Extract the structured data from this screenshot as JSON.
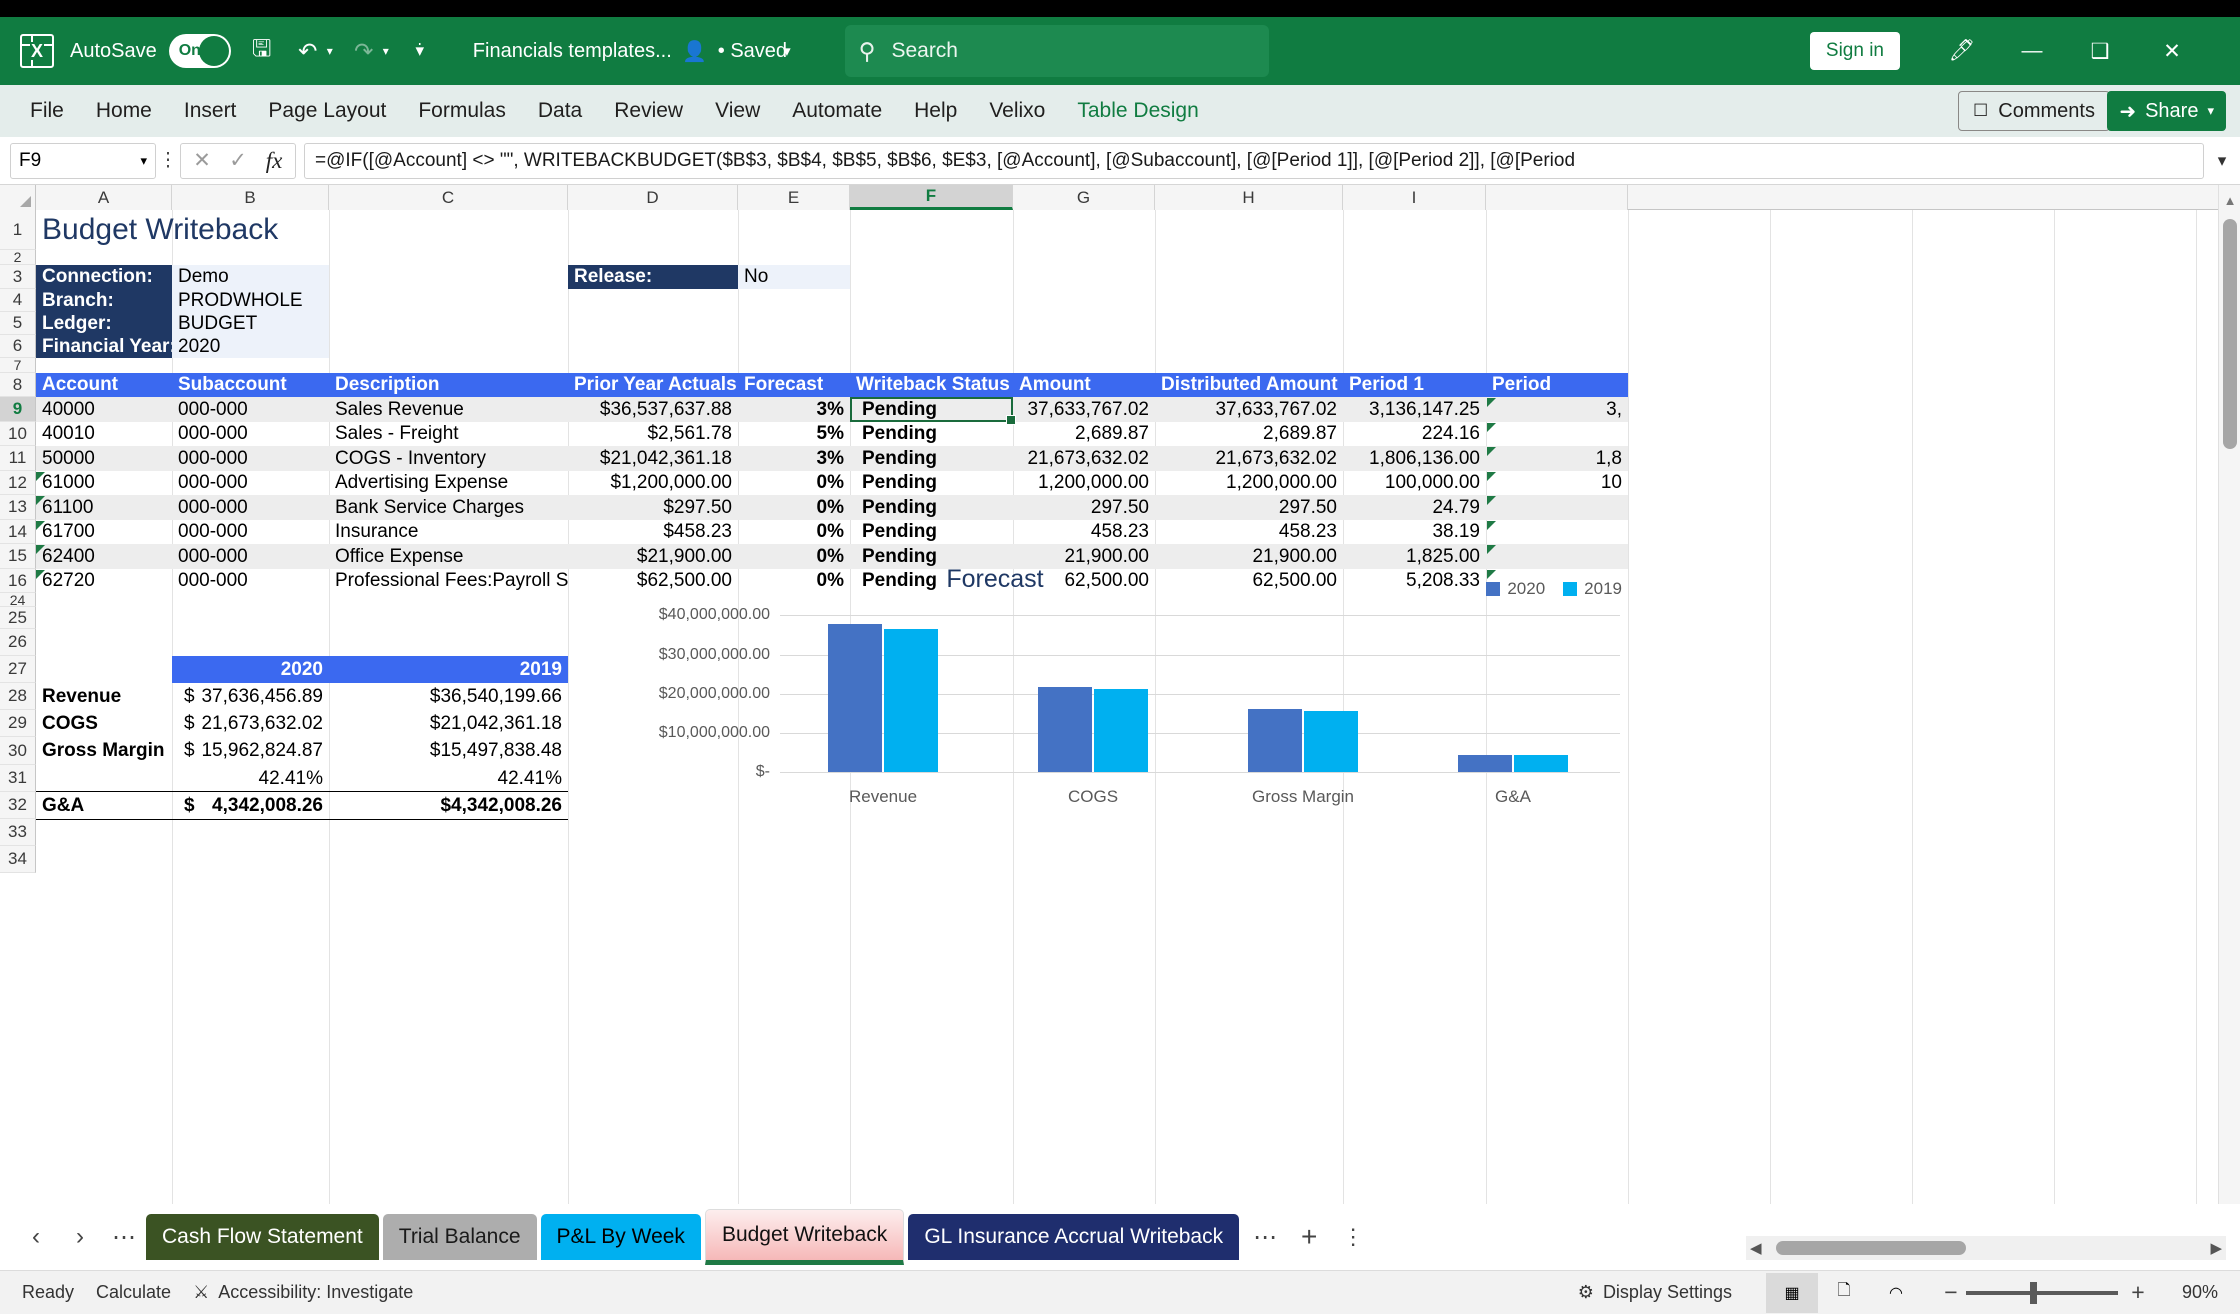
{
  "titlebar": {
    "autosave_label": "AutoSave",
    "autosave_state": "On",
    "doc_title": "Financials templates...",
    "saved_status": "• Saved",
    "search_placeholder": "Search",
    "signin_label": "Sign in"
  },
  "ribbon": {
    "tabs": [
      {
        "label": "File"
      },
      {
        "label": "Home"
      },
      {
        "label": "Insert"
      },
      {
        "label": "Page Layout"
      },
      {
        "label": "Formulas"
      },
      {
        "label": "Data"
      },
      {
        "label": "Review"
      },
      {
        "label": "View"
      },
      {
        "label": "Automate"
      },
      {
        "label": "Help"
      },
      {
        "label": "Velixo"
      },
      {
        "label": "Table Design"
      }
    ],
    "active_tab": "Table Design",
    "comments_label": "Comments",
    "share_label": "Share"
  },
  "formulabar": {
    "namebox_value": "F9",
    "formula": "=@IF([@Account] <> \"\", WRITEBACKBUDGET($B$3, $B$4, $B$5, $B$6, $E$3, [@Account], [@Subaccount], [@[Period 1]], [@[Period 2]], [@[Period"
  },
  "grid": {
    "columns": [
      "A",
      "B",
      "C",
      "D",
      "E",
      "F",
      "G",
      "H",
      "I"
    ],
    "selected_column": "F",
    "rows": [
      "1",
      "2",
      "3",
      "4",
      "5",
      "6",
      "7",
      "8",
      "9",
      "10",
      "11",
      "12",
      "13",
      "14",
      "15",
      "16",
      "24",
      "25",
      "26",
      "27",
      "28",
      "29",
      "30",
      "31",
      "32",
      "33",
      "34"
    ],
    "selected_row": "9",
    "sheet_title": "Budget Writeback",
    "params": [
      {
        "label": "Connection:",
        "value": "Demo"
      },
      {
        "label": "Branch:",
        "value": "PRODWHOLE"
      },
      {
        "label": "Ledger:",
        "value": "BUDGET"
      },
      {
        "label": "Financial Year:",
        "value": "2020"
      }
    ],
    "release": {
      "label": "Release:",
      "value": "No"
    },
    "table_headers": [
      "Account",
      "Subaccount",
      "Description",
      "Prior Year Actuals",
      "Forecast",
      "Writeback Status",
      "Amount",
      "Distributed Amount",
      "Period 1",
      "Period"
    ],
    "table_rows": [
      {
        "row": "9",
        "account": "40000",
        "subaccount": "000-000",
        "description": "Sales Revenue",
        "prior_year_actuals": "$36,537,637.88",
        "forecast": "3%",
        "writeback_status": "Pending",
        "amount": "37,633,767.02",
        "distributed_amount": "37,633,767.02",
        "period1": "3,136,147.25",
        "period2": "3,"
      },
      {
        "row": "10",
        "account": "40010",
        "subaccount": "000-000",
        "description": "Sales - Freight",
        "prior_year_actuals": "$2,561.78",
        "forecast": "5%",
        "writeback_status": "Pending",
        "amount": "2,689.87",
        "distributed_amount": "2,689.87",
        "period1": "224.16",
        "period2": ""
      },
      {
        "row": "11",
        "account": "50000",
        "subaccount": "000-000",
        "description": "COGS - Inventory",
        "prior_year_actuals": "$21,042,361.18",
        "forecast": "3%",
        "writeback_status": "Pending",
        "amount": "21,673,632.02",
        "distributed_amount": "21,673,632.02",
        "period1": "1,806,136.00",
        "period2": "1,8"
      },
      {
        "row": "12",
        "account": "61000",
        "subaccount": "000-000",
        "description": "Advertising Expense",
        "prior_year_actuals": "$1,200,000.00",
        "forecast": "0%",
        "writeback_status": "Pending",
        "amount": "1,200,000.00",
        "distributed_amount": "1,200,000.00",
        "period1": "100,000.00",
        "period2": "10"
      },
      {
        "row": "13",
        "account": "61100",
        "subaccount": "000-000",
        "description": "Bank Service Charges",
        "prior_year_actuals": "$297.50",
        "forecast": "0%",
        "writeback_status": "Pending",
        "amount": "297.50",
        "distributed_amount": "297.50",
        "period1": "24.79",
        "period2": ""
      },
      {
        "row": "14",
        "account": "61700",
        "subaccount": "000-000",
        "description": "Insurance",
        "prior_year_actuals": "$458.23",
        "forecast": "0%",
        "writeback_status": "Pending",
        "amount": "458.23",
        "distributed_amount": "458.23",
        "period1": "38.19",
        "period2": ""
      },
      {
        "row": "15",
        "account": "62400",
        "subaccount": "000-000",
        "description": "Office Expense",
        "prior_year_actuals": "$21,900.00",
        "forecast": "0%",
        "writeback_status": "Pending",
        "amount": "21,900.00",
        "distributed_amount": "21,900.00",
        "period1": "1,825.00",
        "period2": ""
      },
      {
        "row": "16",
        "account": "62720",
        "subaccount": "000-000",
        "description": "Professional Fees:Payroll Servic",
        "prior_year_actuals": "$62,500.00",
        "forecast": "0%",
        "writeback_status": "Pending",
        "amount": "62,500.00",
        "distributed_amount": "62,500.00",
        "period1": "5,208.33",
        "period2": ""
      }
    ],
    "summary": {
      "headers": [
        "2020",
        "2019"
      ],
      "rows": [
        {
          "label": "Revenue",
          "c2020_sym": "$",
          "c2020": "37,636,456.89",
          "c2019": "$36,540,199.66"
        },
        {
          "label": "COGS",
          "c2020_sym": "$",
          "c2020": "21,673,632.02",
          "c2019": "$21,042,361.18"
        },
        {
          "label": "Gross Margin",
          "c2020_sym": "$",
          "c2020": "15,962,824.87",
          "c2019": "$15,497,838.48"
        },
        {
          "label": "",
          "c2020_sym": "",
          "c2020": "42.41%",
          "c2019": "42.41%"
        },
        {
          "label": "G&A",
          "c2020_sym": "$",
          "c2020": "4,342,008.26",
          "c2019": "$4,342,008.26"
        }
      ]
    }
  },
  "chart_data": {
    "type": "bar",
    "title": "Forecast",
    "categories": [
      "Revenue",
      "COGS",
      "Gross Margin",
      "G&A"
    ],
    "series": [
      {
        "name": "2020",
        "color": "#4472C4",
        "values": [
          37636456.89,
          21673632.02,
          15962824.87,
          4342008.26
        ]
      },
      {
        "name": "2019",
        "color": "#00B0F0",
        "values": [
          36540199.66,
          21042361.18,
          15497838.48,
          4342008.26
        ]
      }
    ],
    "ytick_labels": [
      "$40,000,000.00",
      "$30,000,000.00",
      "$20,000,000.00",
      "$10,000,000.00",
      "$-"
    ],
    "ytick_values": [
      40000000,
      30000000,
      20000000,
      10000000,
      0
    ],
    "ylim": [
      0,
      40000000
    ],
    "xlabel": "",
    "ylabel": "",
    "grid": true,
    "legend_position": "top-right"
  },
  "sheettabs": {
    "tabs": [
      {
        "label": "Cash Flow Statement",
        "bg": "#3B5323",
        "fg": "#ffffff",
        "active": false
      },
      {
        "label": "Trial Balance",
        "bg": "#ADADAD",
        "fg": "#1a1a1a",
        "active": false
      },
      {
        "label": "P&L By Week",
        "bg": "#00B0F0",
        "fg": "#000000",
        "active": false
      },
      {
        "label": "Budget Writeback",
        "bg": "#F6B8B8",
        "fg": "#111111",
        "active": true
      },
      {
        "label": "GL Insurance Accrual Writeback",
        "bg": "#1F2E6E",
        "fg": "#ffffff",
        "active": false
      }
    ]
  },
  "statusbar": {
    "ready": "Ready",
    "calculate": "Calculate",
    "accessibility": "Accessibility: Investigate",
    "display_settings": "Display Settings",
    "zoom": "90%"
  }
}
